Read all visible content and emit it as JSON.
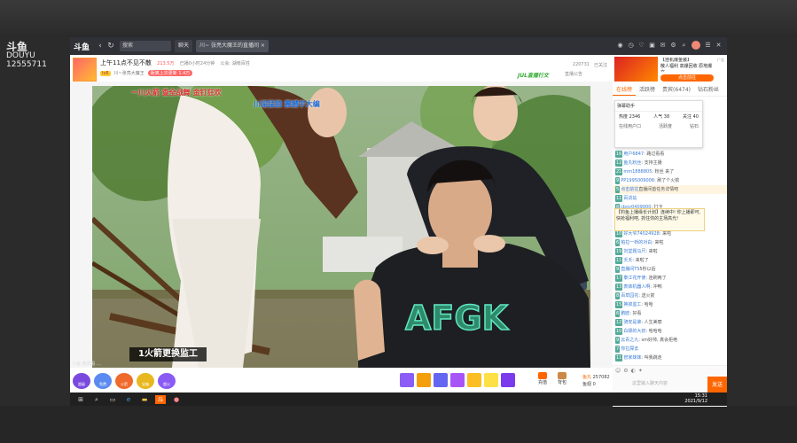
{
  "desktop": {
    "logo_mark": "斗鱼",
    "logo_sub": "DOUYU",
    "room_number": "12555711"
  },
  "browser": {
    "logo": "斗鱼",
    "search_placeholder": "搜索",
    "tabs": [
      {
        "label": "聊天"
      },
      {
        "label": "川~ 张亮大魔王的直播间"
      }
    ]
  },
  "room": {
    "title": "上午11点不见不散",
    "heat": "213.5万",
    "meta1": "已播0小时24分钟",
    "meta2": "公会: 湖南百姓",
    "badge": "lv6",
    "anchor": "川~张亮大魔王",
    "pill": "距离上次更新 1.4万",
    "right_id": "220731",
    "right_follow": "已关注",
    "right_share": "直播公告",
    "streamer_tag": "JUL直播行文"
  },
  "video": {
    "overlay_left": "一川火箭  查全战舞  金钉狂欢",
    "overlay_right": "川渝猛猿  震撼宇大编",
    "caption": "1火箭更换监工",
    "jersey_text": "AFGK",
    "status_line": "斗鱼  我观看 ..."
  },
  "gifts_left": [
    {
      "label": "超级",
      "color": "#7a4adf"
    },
    {
      "label": "免费",
      "color": "#5b8bf0"
    },
    {
      "label": "火箭",
      "color": "#f06a2a"
    },
    {
      "label": "宝箱",
      "color": "#e8b820"
    },
    {
      "label": "超火",
      "color": "#8a5af5"
    }
  ],
  "gifts_right": [
    "#8b5cf6",
    "#f59e0b",
    "#6366f1",
    "#a855f7",
    "#fbbf24",
    "#fde047",
    "#7c3aed"
  ],
  "bottom": {
    "charge_label": "充值",
    "pack_label": "背包",
    "fire_label": "鱼丸",
    "fire_value": "257082",
    "yuchi_label": "鱼翅",
    "yuchi_value": "0"
  },
  "sidebar": {
    "ad": {
      "tag": "广告",
      "title": "【挂机爆金装】",
      "text": "散人福利 高爆回收 原地爆充...",
      "button": "点击前往"
    },
    "tabs": [
      {
        "label": "在线榜"
      },
      {
        "label": "活跃榜"
      },
      {
        "label": "贵宾(6474)"
      },
      {
        "label": "钻石粉丝"
      }
    ],
    "popup": {
      "title": "弹幕助手",
      "stat1_label": "热度",
      "stat1_value": "2346",
      "stat2_label": "人气",
      "stat2_value": "38",
      "stat3_label": "关注",
      "stat3_value": "40",
      "row2": [
        "在线用户口",
        "活跃度",
        "钻石"
      ]
    },
    "notice": "【钓鱼上播缘长计划】连续中! 你上播即可, 快抢福利吧, 抓住你的主场高光!",
    "chat": [
      {
        "lv": "16",
        "name": "用户6847",
        "text": ": 路过看看",
        "hl": false
      },
      {
        "lv": "12",
        "name": "鱼丸粉丝",
        "text": ": 支持主播",
        "hl": false
      },
      {
        "lv": "21",
        "name": "mm1888805",
        "text": ": 粉丝 来了",
        "hl": false
      },
      {
        "lv": "9",
        "name": "PP1995009006",
        "text": ": 刷了个火箭",
        "hl": false
      },
      {
        "lv": "5",
        "name": "点击前往",
        "text": "直播间首任务详情吧",
        "hl": true
      },
      {
        "lv": "11",
        "name": "百货站",
        "text": "",
        "hl": false
      },
      {
        "lv": "8",
        "name": "cboy0409000",
        "text": ": 打卡",
        "hl": false
      },
      {
        "lv": "14",
        "name": "清风明月",
        "text": ": 好看",
        "hl": false
      },
      {
        "lv": "7",
        "name": "小梦",
        "text": ": 加油",
        "hl": false
      },
      {
        "lv": "10",
        "name": "好大爷74024928",
        "text": ": 来啦",
        "hl": false
      },
      {
        "lv": "6",
        "name": "帕拉一桥的对白",
        "text": ": 来啦",
        "hl": false
      },
      {
        "lv": "19",
        "name": "刘堂题马尺",
        "text": ": 来啦",
        "hl": false
      },
      {
        "lv": "11",
        "name": "夭夭",
        "text": ": 来啦了",
        "hl": false
      },
      {
        "lv": "9",
        "name": "直播间TS",
        "text": "5秒以后",
        "hl": false
      },
      {
        "lv": "17",
        "name": "泰江花开使",
        "text": ": 连刷两了",
        "hl": false
      },
      {
        "lv": "13",
        "name": "表妹机器人啊",
        "text": ": 冲鸭",
        "hl": false
      },
      {
        "lv": "8",
        "name": "百草园花",
        "text": ": 送火箭",
        "hl": false
      },
      {
        "lv": "15",
        "name": "换掉监工",
        "text": ": 哈哈",
        "hl": false
      },
      {
        "lv": "6",
        "name": "鹏欧",
        "text": ": 好看",
        "hl": false
      },
      {
        "lv": "12",
        "name": "骑安是谁",
        "text": ": 人生美丽",
        "hl": false
      },
      {
        "lv": "10",
        "name": "白嫖的大叔",
        "text": ": 哈哈哈",
        "hl": false
      },
      {
        "lv": "9",
        "name": "云青之九",
        "text": ": sm好帅, 真会拒绝",
        "hl": false
      },
      {
        "lv": "7",
        "name": "你拉屎去",
        "text": "",
        "hl": false
      },
      {
        "lv": "11",
        "name": "管家妹妹",
        "text": ": 叫我跳走",
        "hl": false
      },
      {
        "lv": "14",
        "name": "表姐跟跌先",
        "text": ": 川渝猛猿",
        "hl": false
      },
      {
        "lv": "8",
        "name": "大蒋",
        "text": ": 叫我跳",
        "hl": false
      },
      {
        "lv": "13",
        "name": "梦里来是外",
        "text": ": 来了",
        "hl": false
      }
    ],
    "input_placeholder": "这里输入聊天内容",
    "send_label": "发送"
  },
  "taskbar": {
    "time": "15:31",
    "date": "2021/9/12"
  }
}
